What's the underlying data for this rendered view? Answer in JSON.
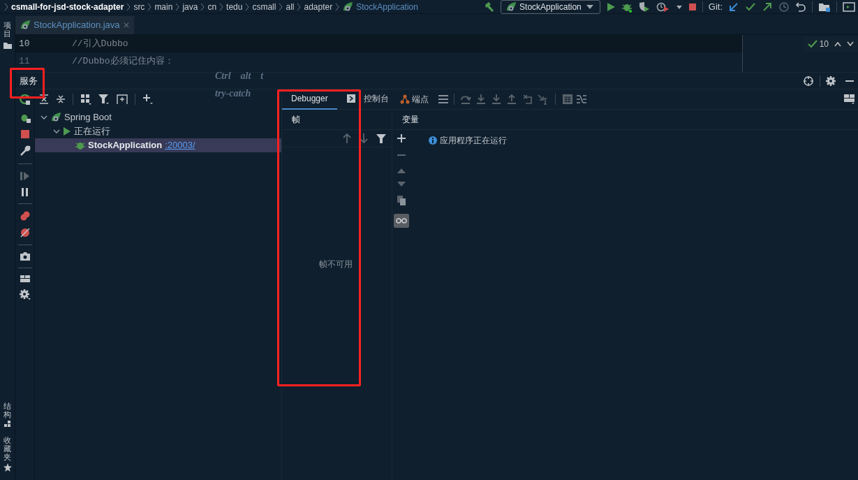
{
  "breadcrumb": [
    "csmall-for-jsd-stock-adapter",
    "src",
    "main",
    "java",
    "cn",
    "tedu",
    "csmall",
    "all",
    "adapter",
    "StockApplication"
  ],
  "run_config": "StockApplication",
  "git_label": "Git:",
  "left_tool_tabs": {
    "top": [
      "项目"
    ],
    "bottom": [
      "结构",
      "收藏夹"
    ]
  },
  "editor_tabs": [
    {
      "label": "StockApplication.java",
      "selected": true
    }
  ],
  "code_lines": [
    {
      "number": "10",
      "text": "//引入Dubbo",
      "current": true
    },
    {
      "number": "11",
      "text": "//Dubbo必须记住内容：",
      "current": false
    }
  ],
  "inspection_count": "10",
  "services_panel": {
    "title": "服务",
    "handwriting": [
      "Ctrl",
      "alt",
      "t",
      "try-catch"
    ]
  },
  "tree": [
    {
      "label": "Spring Boot",
      "kind": "group",
      "expanded": true,
      "selected": false,
      "children": [
        {
          "label": "正在运行",
          "kind": "status",
          "expanded": true,
          "selected": false,
          "children": [
            {
              "label": "StockApplication",
              "kind": "app",
              "link": ":20003/",
              "selected": true
            }
          ]
        }
      ]
    }
  ],
  "debugger_tabs": [
    {
      "label": "Debugger",
      "selected": true
    },
    {
      "label": "控制台",
      "selected": false
    }
  ],
  "breakpoints_label": "端点",
  "frames": {
    "title": "帧",
    "empty_text": "帧不可用"
  },
  "variables": {
    "title": "变量",
    "message": "应用程序正在运行"
  }
}
